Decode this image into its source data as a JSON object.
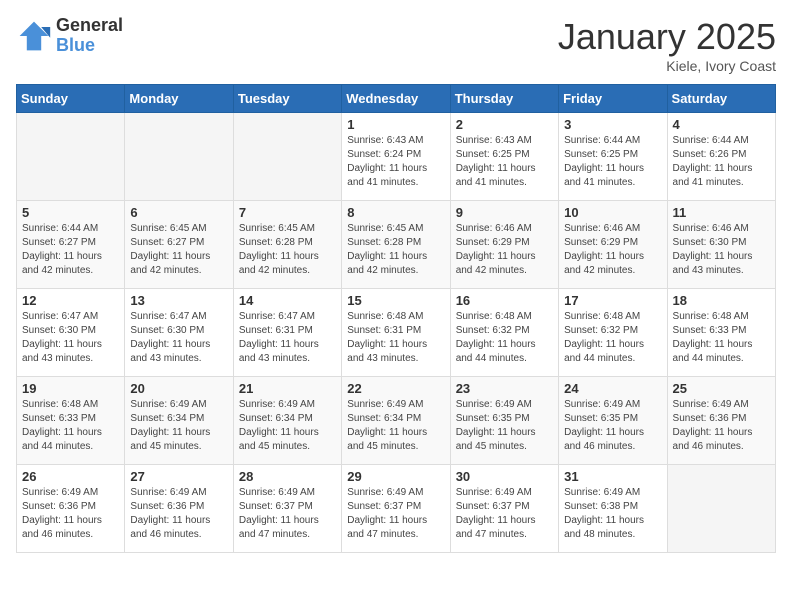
{
  "logo": {
    "general": "General",
    "blue": "Blue"
  },
  "title": "January 2025",
  "location": "Kiele, Ivory Coast",
  "days_header": [
    "Sunday",
    "Monday",
    "Tuesday",
    "Wednesday",
    "Thursday",
    "Friday",
    "Saturday"
  ],
  "weeks": [
    [
      {
        "day": "",
        "info": ""
      },
      {
        "day": "",
        "info": ""
      },
      {
        "day": "",
        "info": ""
      },
      {
        "day": "1",
        "info": "Sunrise: 6:43 AM\nSunset: 6:24 PM\nDaylight: 11 hours\nand 41 minutes."
      },
      {
        "day": "2",
        "info": "Sunrise: 6:43 AM\nSunset: 6:25 PM\nDaylight: 11 hours\nand 41 minutes."
      },
      {
        "day": "3",
        "info": "Sunrise: 6:44 AM\nSunset: 6:25 PM\nDaylight: 11 hours\nand 41 minutes."
      },
      {
        "day": "4",
        "info": "Sunrise: 6:44 AM\nSunset: 6:26 PM\nDaylight: 11 hours\nand 41 minutes."
      }
    ],
    [
      {
        "day": "5",
        "info": "Sunrise: 6:44 AM\nSunset: 6:27 PM\nDaylight: 11 hours\nand 42 minutes."
      },
      {
        "day": "6",
        "info": "Sunrise: 6:45 AM\nSunset: 6:27 PM\nDaylight: 11 hours\nand 42 minutes."
      },
      {
        "day": "7",
        "info": "Sunrise: 6:45 AM\nSunset: 6:28 PM\nDaylight: 11 hours\nand 42 minutes."
      },
      {
        "day": "8",
        "info": "Sunrise: 6:45 AM\nSunset: 6:28 PM\nDaylight: 11 hours\nand 42 minutes."
      },
      {
        "day": "9",
        "info": "Sunrise: 6:46 AM\nSunset: 6:29 PM\nDaylight: 11 hours\nand 42 minutes."
      },
      {
        "day": "10",
        "info": "Sunrise: 6:46 AM\nSunset: 6:29 PM\nDaylight: 11 hours\nand 42 minutes."
      },
      {
        "day": "11",
        "info": "Sunrise: 6:46 AM\nSunset: 6:30 PM\nDaylight: 11 hours\nand 43 minutes."
      }
    ],
    [
      {
        "day": "12",
        "info": "Sunrise: 6:47 AM\nSunset: 6:30 PM\nDaylight: 11 hours\nand 43 minutes."
      },
      {
        "day": "13",
        "info": "Sunrise: 6:47 AM\nSunset: 6:30 PM\nDaylight: 11 hours\nand 43 minutes."
      },
      {
        "day": "14",
        "info": "Sunrise: 6:47 AM\nSunset: 6:31 PM\nDaylight: 11 hours\nand 43 minutes."
      },
      {
        "day": "15",
        "info": "Sunrise: 6:48 AM\nSunset: 6:31 PM\nDaylight: 11 hours\nand 43 minutes."
      },
      {
        "day": "16",
        "info": "Sunrise: 6:48 AM\nSunset: 6:32 PM\nDaylight: 11 hours\nand 44 minutes."
      },
      {
        "day": "17",
        "info": "Sunrise: 6:48 AM\nSunset: 6:32 PM\nDaylight: 11 hours\nand 44 minutes."
      },
      {
        "day": "18",
        "info": "Sunrise: 6:48 AM\nSunset: 6:33 PM\nDaylight: 11 hours\nand 44 minutes."
      }
    ],
    [
      {
        "day": "19",
        "info": "Sunrise: 6:48 AM\nSunset: 6:33 PM\nDaylight: 11 hours\nand 44 minutes."
      },
      {
        "day": "20",
        "info": "Sunrise: 6:49 AM\nSunset: 6:34 PM\nDaylight: 11 hours\nand 45 minutes."
      },
      {
        "day": "21",
        "info": "Sunrise: 6:49 AM\nSunset: 6:34 PM\nDaylight: 11 hours\nand 45 minutes."
      },
      {
        "day": "22",
        "info": "Sunrise: 6:49 AM\nSunset: 6:34 PM\nDaylight: 11 hours\nand 45 minutes."
      },
      {
        "day": "23",
        "info": "Sunrise: 6:49 AM\nSunset: 6:35 PM\nDaylight: 11 hours\nand 45 minutes."
      },
      {
        "day": "24",
        "info": "Sunrise: 6:49 AM\nSunset: 6:35 PM\nDaylight: 11 hours\nand 46 minutes."
      },
      {
        "day": "25",
        "info": "Sunrise: 6:49 AM\nSunset: 6:36 PM\nDaylight: 11 hours\nand 46 minutes."
      }
    ],
    [
      {
        "day": "26",
        "info": "Sunrise: 6:49 AM\nSunset: 6:36 PM\nDaylight: 11 hours\nand 46 minutes."
      },
      {
        "day": "27",
        "info": "Sunrise: 6:49 AM\nSunset: 6:36 PM\nDaylight: 11 hours\nand 46 minutes."
      },
      {
        "day": "28",
        "info": "Sunrise: 6:49 AM\nSunset: 6:37 PM\nDaylight: 11 hours\nand 47 minutes."
      },
      {
        "day": "29",
        "info": "Sunrise: 6:49 AM\nSunset: 6:37 PM\nDaylight: 11 hours\nand 47 minutes."
      },
      {
        "day": "30",
        "info": "Sunrise: 6:49 AM\nSunset: 6:37 PM\nDaylight: 11 hours\nand 47 minutes."
      },
      {
        "day": "31",
        "info": "Sunrise: 6:49 AM\nSunset: 6:38 PM\nDaylight: 11 hours\nand 48 minutes."
      },
      {
        "day": "",
        "info": ""
      }
    ]
  ]
}
